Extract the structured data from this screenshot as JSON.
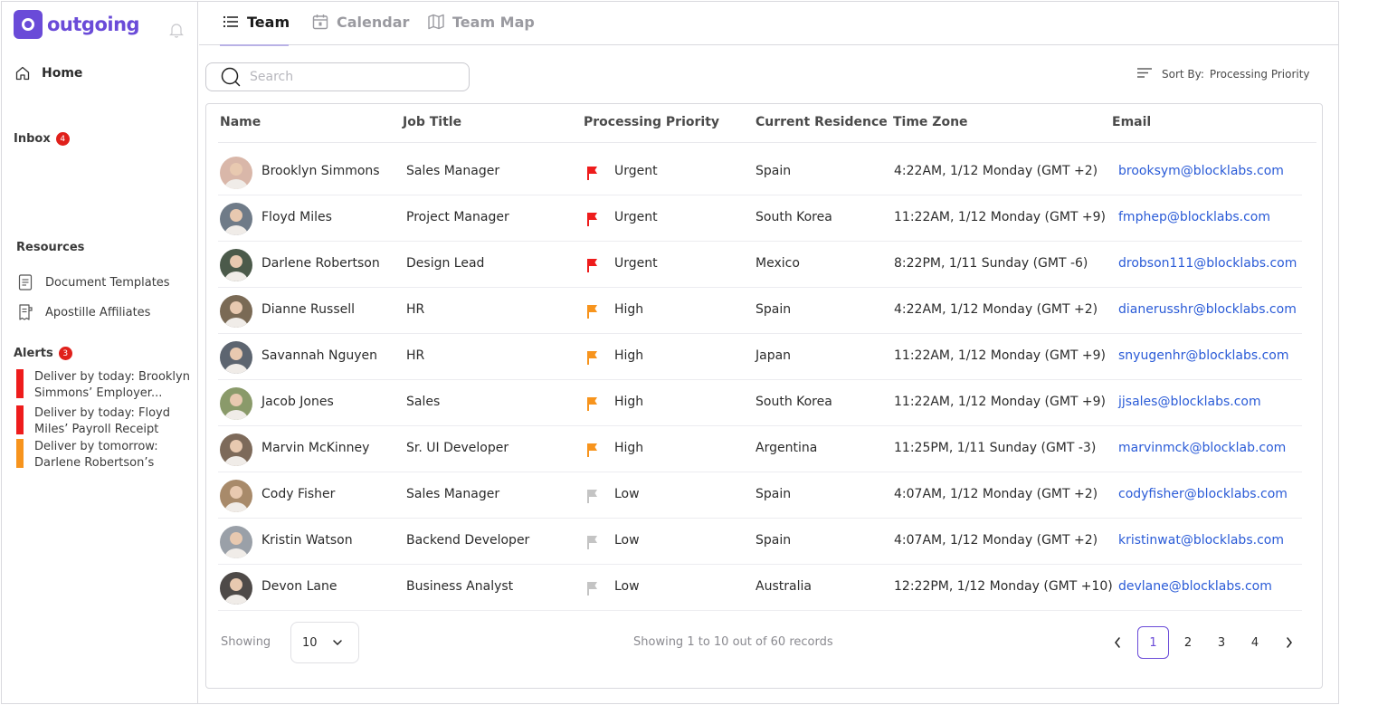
{
  "app": {
    "name": "outgoing"
  },
  "sidebar": {
    "home_label": "Home",
    "inbox_label": "Inbox",
    "inbox_count": "4",
    "resources_title": "Resources",
    "resources": [
      {
        "label": "Document Templates",
        "icon": "document-icon"
      },
      {
        "label": "Apostille Affiliates",
        "icon": "receipt-icon"
      }
    ],
    "alerts_title": "Alerts",
    "alerts_count": "3",
    "alerts": [
      {
        "text": "Deliver by today: Brooklyn Simmons’ Employer...",
        "color": "#ee1c1c"
      },
      {
        "text": "Deliver by today: Floyd Miles’ Payroll Receipt",
        "color": "#ee1c1c"
      },
      {
        "text": "Deliver by tomorrow: Darlene Robertson’s Proof...",
        "color": "#f7941d"
      }
    ]
  },
  "tabs": [
    {
      "label": "Team",
      "icon": "list-icon",
      "active": true
    },
    {
      "label": "Calendar",
      "icon": "calendar-icon",
      "active": false
    },
    {
      "label": "Team Map",
      "icon": "map-icon",
      "active": false
    }
  ],
  "search": {
    "placeholder": "Search",
    "value": ""
  },
  "sort": {
    "label": "Sort By:",
    "value": "Processing Priority"
  },
  "table": {
    "columns": [
      "Name",
      "Job Title",
      "Processing Priority",
      "Current Residence",
      "Time Zone",
      "Email"
    ],
    "rows": [
      {
        "name": "Brooklyn Simmons",
        "job": "Sales Manager",
        "priority": "Urgent",
        "residence": "Spain",
        "timezone": "4:22AM, 1/12 Monday (GMT +2)",
        "email": "brooksym@blocklabs.com"
      },
      {
        "name": "Floyd Miles",
        "job": "Project Manager",
        "priority": "Urgent",
        "residence": "South Korea",
        "timezone": "11:22AM, 1/12 Monday (GMT +9)",
        "email": "fmphep@blocklabs.com"
      },
      {
        "name": "Darlene Robertson",
        "job": "Design Lead",
        "priority": "Urgent",
        "residence": "Mexico",
        "timezone": "8:22PM, 1/11 Sunday (GMT -6)",
        "email": "drobson111@blocklabs.com"
      },
      {
        "name": "Dianne Russell",
        "job": "HR",
        "priority": "High",
        "residence": "Spain",
        "timezone": "4:22AM, 1/12 Monday (GMT +2)",
        "email": "dianerusshr@blocklabs.com"
      },
      {
        "name": "Savannah Nguyen",
        "job": "HR",
        "priority": "High",
        "residence": "Japan",
        "timezone": "11:22AM, 1/12 Monday (GMT +9)",
        "email": "snyugenhr@blocklabs.com"
      },
      {
        "name": "Jacob Jones",
        "job": "Sales",
        "priority": "High",
        "residence": "South Korea",
        "timezone": "11:22AM, 1/12 Monday (GMT +9)",
        "email": "jjsales@blocklabs.com"
      },
      {
        "name": "Marvin McKinney",
        "job": "Sr. UI Developer",
        "priority": "High",
        "residence": "Argentina",
        "timezone": "11:25PM, 1/11 Sunday (GMT -3)",
        "email": "marvinmck@blocklab.com"
      },
      {
        "name": "Cody Fisher",
        "job": "Sales Manager",
        "priority": "Low",
        "residence": "Spain",
        "timezone": "4:07AM, 1/12 Monday (GMT +2)",
        "email": "codyfisher@blocklabs.com"
      },
      {
        "name": "Kristin Watson",
        "job": "Backend Developer",
        "priority": "Low",
        "residence": "Spain",
        "timezone": "4:07AM, 1/12 Monday (GMT +2)",
        "email": "kristinwat@blocklabs.com"
      },
      {
        "name": "Devon Lane",
        "job": "Business Analyst",
        "priority": "Low",
        "residence": "Australia",
        "timezone": "12:22PM, 1/12 Monday (GMT +10)",
        "email": "devlane@blocklabs.com"
      }
    ]
  },
  "priority_colors": {
    "Urgent": "#ee1c1c",
    "High": "#f7941d",
    "Low": "#c4c4c4"
  },
  "footer": {
    "showing_label": "Showing",
    "per_page": "10",
    "records_text": "Showing 1 to 10 out of 60 records",
    "pages": [
      "1",
      "2",
      "3",
      "4"
    ],
    "current_page": "1"
  },
  "colors": {
    "brand": "#6a4bd8",
    "link": "#2a5bd7"
  }
}
